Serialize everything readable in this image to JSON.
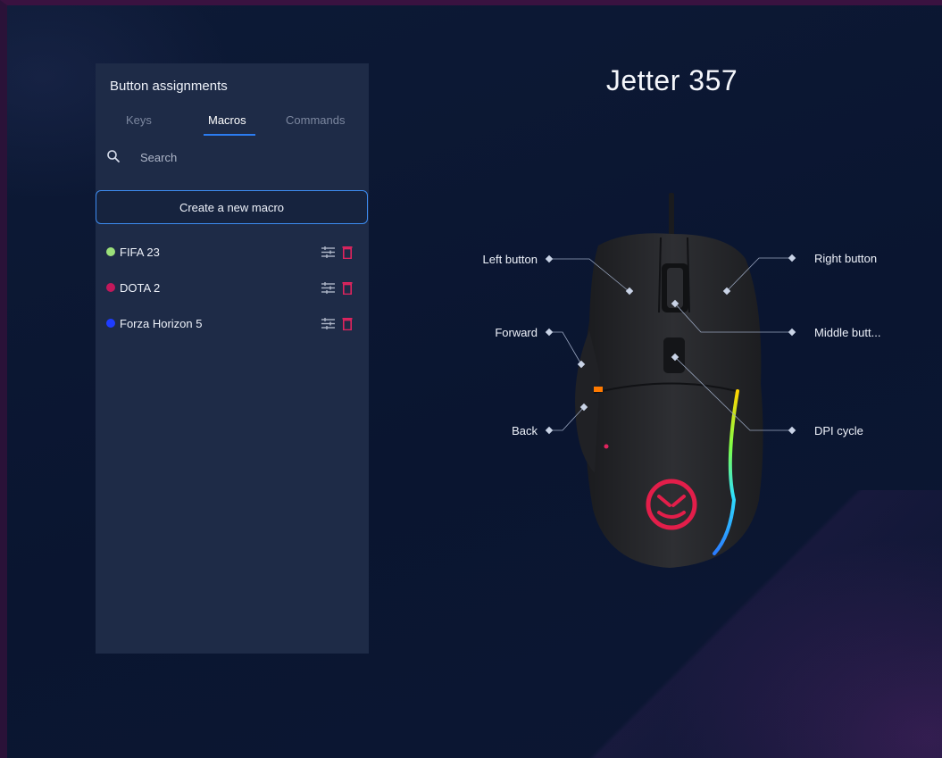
{
  "panel": {
    "title": "Button assignments",
    "tabs": [
      {
        "label": "Keys",
        "active": false
      },
      {
        "label": "Macros",
        "active": true
      },
      {
        "label": "Commands",
        "active": false
      }
    ],
    "search": {
      "placeholder": "Search",
      "icon": "search-icon"
    },
    "create_button": "Create a new macro",
    "macros": [
      {
        "name": "FIFA 23",
        "color": "#9be07a"
      },
      {
        "name": "DOTA 2",
        "color": "#c2185b"
      },
      {
        "name": "Forza Horizon 5",
        "color": "#1e3cff"
      }
    ]
  },
  "device": {
    "title": "Jetter 357",
    "callouts": {
      "left_button": "Left button",
      "right_button": "Right button",
      "forward": "Forward",
      "middle_button": "Middle butt...",
      "back": "Back",
      "dpi_cycle": "DPI cycle"
    }
  },
  "colors": {
    "accent": "#2b7cf0",
    "delete": "#e0245e",
    "panel_bg": "#1e2b47",
    "page_bg": "#0b1630"
  }
}
